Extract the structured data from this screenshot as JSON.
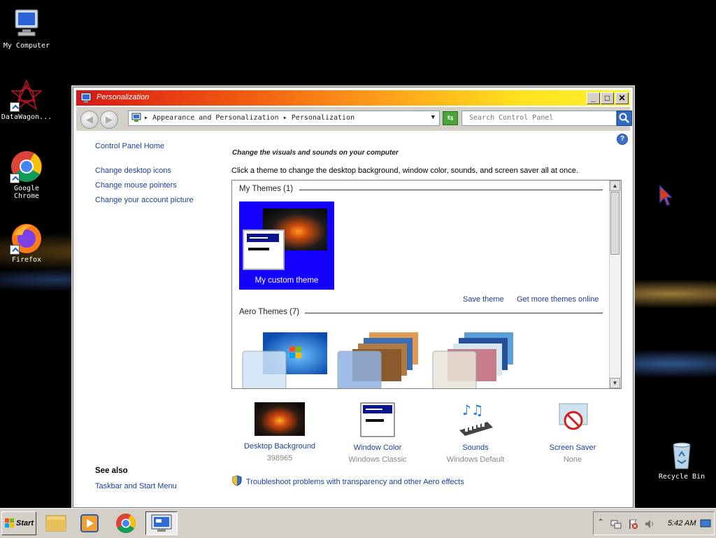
{
  "desktop": {
    "icons": [
      {
        "label": "My Computer",
        "icon": "computer-icon"
      },
      {
        "label": "DataWagon...",
        "icon": "datawagon-icon"
      },
      {
        "label": "Google Chrome",
        "icon": "chrome-icon"
      },
      {
        "label": "Firefox",
        "icon": "firefox-icon"
      },
      {
        "label": "Recycle Bin",
        "icon": "recycle-bin-icon"
      }
    ]
  },
  "window": {
    "title": "Personalization",
    "controls": {
      "minimize": "_",
      "maximize": "□",
      "close": "✕"
    },
    "address": {
      "crumb1": "Appearance and Personalization",
      "crumb2": "Personalization",
      "sep": "▸"
    },
    "search": {
      "placeholder": "Search Control Panel"
    }
  },
  "leftpane": {
    "home": "Control Panel Home",
    "links": [
      "Change desktop icons",
      "Change mouse pointers",
      "Change your account picture"
    ],
    "see_also_title": "See also",
    "see_also_links": [
      "Taskbar and Start Menu"
    ]
  },
  "main": {
    "heading": "Change the visuals and sounds on your computer",
    "instruction": "Click a theme to change the desktop background, window color, sounds, and screen saver all at once.",
    "my_themes_title": "My Themes (1)",
    "custom_theme_label": "My custom theme",
    "save_theme": "Save theme",
    "get_more": "Get more themes online",
    "aero_themes_title": "Aero Themes (7)",
    "tiles": [
      {
        "label": "Desktop Background",
        "sub": "398965"
      },
      {
        "label": "Window Color",
        "sub": "Windows Classic"
      },
      {
        "label": "Sounds",
        "sub": "Windows Default"
      },
      {
        "label": "Screen Saver",
        "sub": "None"
      }
    ],
    "troubleshoot": "Troubleshoot problems with transparency and other Aero effects"
  },
  "taskbar": {
    "start_label": "Start",
    "clock": "5:42 AM"
  }
}
